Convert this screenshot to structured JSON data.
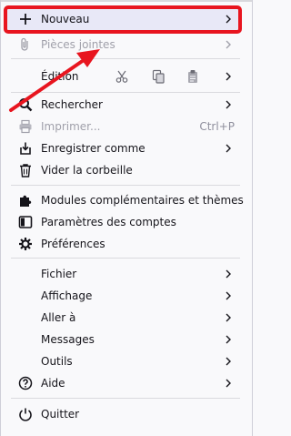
{
  "menu": {
    "new": {
      "label": "Nouveau",
      "icon": "plus-icon"
    },
    "attachments": {
      "label": "Pièces jointes",
      "icon": "paperclip-icon"
    },
    "edit": {
      "label": "Édition",
      "tools": [
        "cut-icon",
        "copy-icon",
        "paste-icon"
      ]
    },
    "find": {
      "label": "Rechercher",
      "icon": "search-icon"
    },
    "print": {
      "label": "Imprimer...",
      "accel": "Ctrl+P",
      "icon": "printer-icon"
    },
    "save_as": {
      "label": "Enregistrer comme",
      "icon": "save-icon"
    },
    "empty_trash": {
      "label": "Vider la corbeille",
      "icon": "trash-icon"
    },
    "addons": {
      "label": "Modules complémentaires et thèmes",
      "icon": "puzzle-icon"
    },
    "account_settings": {
      "label": "Paramètres des comptes",
      "icon": "account-settings-icon"
    },
    "preferences": {
      "label": "Préférences",
      "icon": "gear-icon"
    },
    "file": {
      "label": "Fichier"
    },
    "view": {
      "label": "Affichage"
    },
    "go": {
      "label": "Aller à"
    },
    "messages": {
      "label": "Messages"
    },
    "tools": {
      "label": "Outils"
    },
    "help": {
      "label": "Aide",
      "icon": "help-icon"
    },
    "quit": {
      "label": "Quitter",
      "icon": "power-icon"
    }
  },
  "annotation": {
    "highlight_color": "#e8151f",
    "arrow": "red-arrow"
  }
}
